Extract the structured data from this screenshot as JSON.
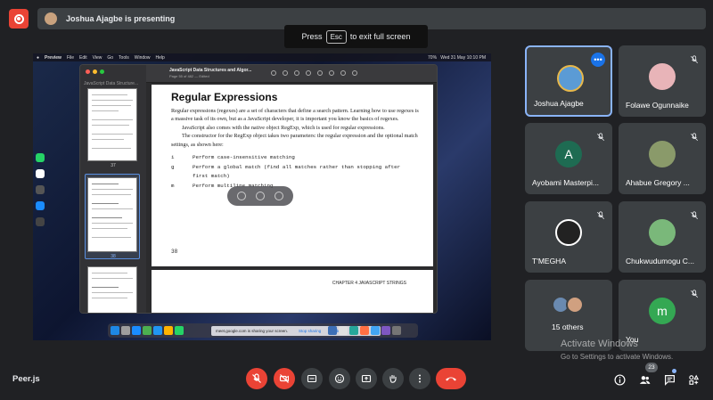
{
  "banner": {
    "presenter_text": "Joshua Ajagbe is presenting"
  },
  "esc_hint": {
    "before": "Press",
    "key": "Esc",
    "after": "to exit full screen"
  },
  "shared_screen": {
    "menubar": {
      "app": "Preview",
      "menus": [
        "File",
        "Edit",
        "View",
        "Go",
        "Tools",
        "Window",
        "Help"
      ],
      "clock": "Wed 31 May  10:10 PM",
      "battery": "70%"
    },
    "preview": {
      "sidebar_title": "JavaScript Data Structure...",
      "doc_title": "JavaScript Data Structures and Algor...",
      "doc_subtitle": "Page 55 of 482 — Edited",
      "thumb_pages": [
        "37",
        "38"
      ],
      "page": {
        "heading": "Regular Expressions",
        "para1": "Regular expressions (regexes) are a set of characters that define a search pattern. Learning how to use regexes is a massive task of its own, but as a JavaScript developer, it is important you know the basics of regexes.",
        "para2": "JavaScript also comes with the native object RegExp, which is used for regular expressions.",
        "para3": "The constructor for the RegExp object takes two parameters: the regular expression and the optional match settings, as shown here:",
        "flags": [
          {
            "key": "i",
            "desc": "Perform case-insensitive matching"
          },
          {
            "key": "g",
            "desc": "Perform a global match (find all matches rather than stopping after first match)"
          },
          {
            "key": "m",
            "desc": "Perform multiline matching"
          }
        ],
        "page_number": "38"
      },
      "next_page_header": "CHAPTER 4    JAVASCRIPT STRINGS"
    },
    "share_bar": {
      "text": "meet.google.com is sharing your screen.",
      "stop": "Stop sharing",
      "hide": "Hide"
    }
  },
  "participants": [
    {
      "name": "Joshua Ajagbe",
      "active": true,
      "color": "#5b9bd5"
    },
    {
      "name": "Folawe Ogunnaike",
      "muted": true,
      "color": "#e8b4b8"
    },
    {
      "name": "Ayobami Masterpi...",
      "muted": true,
      "initial": "A",
      "color": "#1e6b52"
    },
    {
      "name": "Ahabue Gregory ...",
      "muted": true,
      "color": "#8a9a6a"
    },
    {
      "name": "T'MEGHA",
      "muted": true,
      "color": "#222222"
    },
    {
      "name": "Chukwudumogu C...",
      "muted": true,
      "color": "#7ab87a"
    },
    {
      "name": "15 others",
      "color": "#6a8ab0"
    },
    {
      "name": "You",
      "muted": true,
      "initial": "m",
      "color": "#34a853"
    }
  ],
  "watermark": {
    "line1": "Activate Windows",
    "line2": "Go to Settings to activate Windows."
  },
  "bottom_bar": {
    "meeting_name": "Peer.js",
    "participant_count": "23",
    "colors": {
      "danger": "#ea4335",
      "control_bg": "#3c4043",
      "accent": "#8ab4f8"
    }
  }
}
